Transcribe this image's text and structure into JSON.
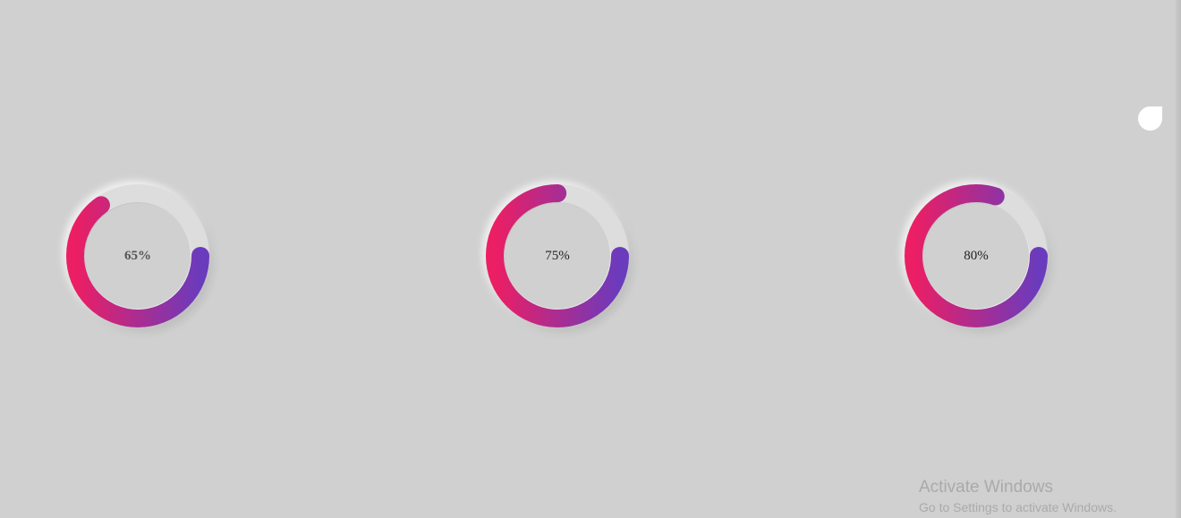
{
  "gauges": [
    {
      "id": "gauge-1",
      "value": 65,
      "label": "65%"
    },
    {
      "id": "gauge-2",
      "value": 75,
      "label": "75%"
    },
    {
      "id": "gauge-3",
      "value": 80,
      "label": "80%"
    }
  ],
  "colors": {
    "background": "#cfd0cf",
    "gradient_start": "#ec1e64",
    "gradient_end": "#6a3bbd",
    "track": "#dcdddc"
  },
  "watermark": {
    "title": "Activate Windows",
    "subtitle": "Go to Settings to activate Windows."
  }
}
